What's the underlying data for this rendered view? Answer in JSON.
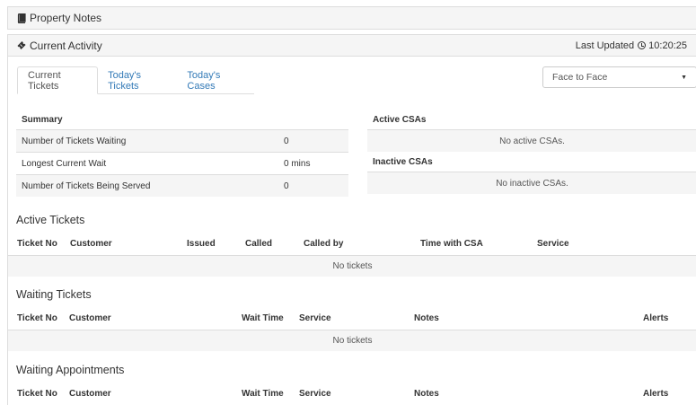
{
  "property_notes": {
    "title": "Property Notes",
    "icon": "book-icon"
  },
  "current_activity": {
    "title": "Current Activity",
    "icon": "ticket-icon",
    "last_updated_label": "Last Updated",
    "last_updated_time": "10:20:25"
  },
  "tabs": [
    {
      "label": "Current Tickets",
      "active": true
    },
    {
      "label": "Today's Tickets",
      "active": false
    },
    {
      "label": "Today's Cases",
      "active": false
    }
  ],
  "mode_select": {
    "value": "Face to Face"
  },
  "summary": {
    "title": "Summary",
    "rows": [
      {
        "label": "Number of Tickets Waiting",
        "value": "0"
      },
      {
        "label": "Longest Current Wait",
        "value": "0 mins"
      },
      {
        "label": "Number of Tickets Being Served",
        "value": "0"
      }
    ]
  },
  "active_csas": {
    "title": "Active CSAs",
    "empty": "No active CSAs."
  },
  "inactive_csas": {
    "title": "Inactive CSAs",
    "empty": "No inactive CSAs."
  },
  "active_tickets": {
    "title": "Active Tickets",
    "columns": [
      "Ticket No",
      "Customer",
      "Issued",
      "Called",
      "Called by",
      "Time with CSA",
      "Service"
    ],
    "empty": "No tickets"
  },
  "waiting_tickets": {
    "title": "Waiting Tickets",
    "columns": [
      "Ticket No",
      "Customer",
      "Wait Time",
      "Service",
      "Notes",
      "Alerts"
    ],
    "empty": "No tickets"
  },
  "waiting_appointments": {
    "title": "Waiting Appointments",
    "columns": [
      "Ticket No",
      "Customer",
      "Wait Time",
      "Service",
      "Notes",
      "Alerts"
    ]
  }
}
